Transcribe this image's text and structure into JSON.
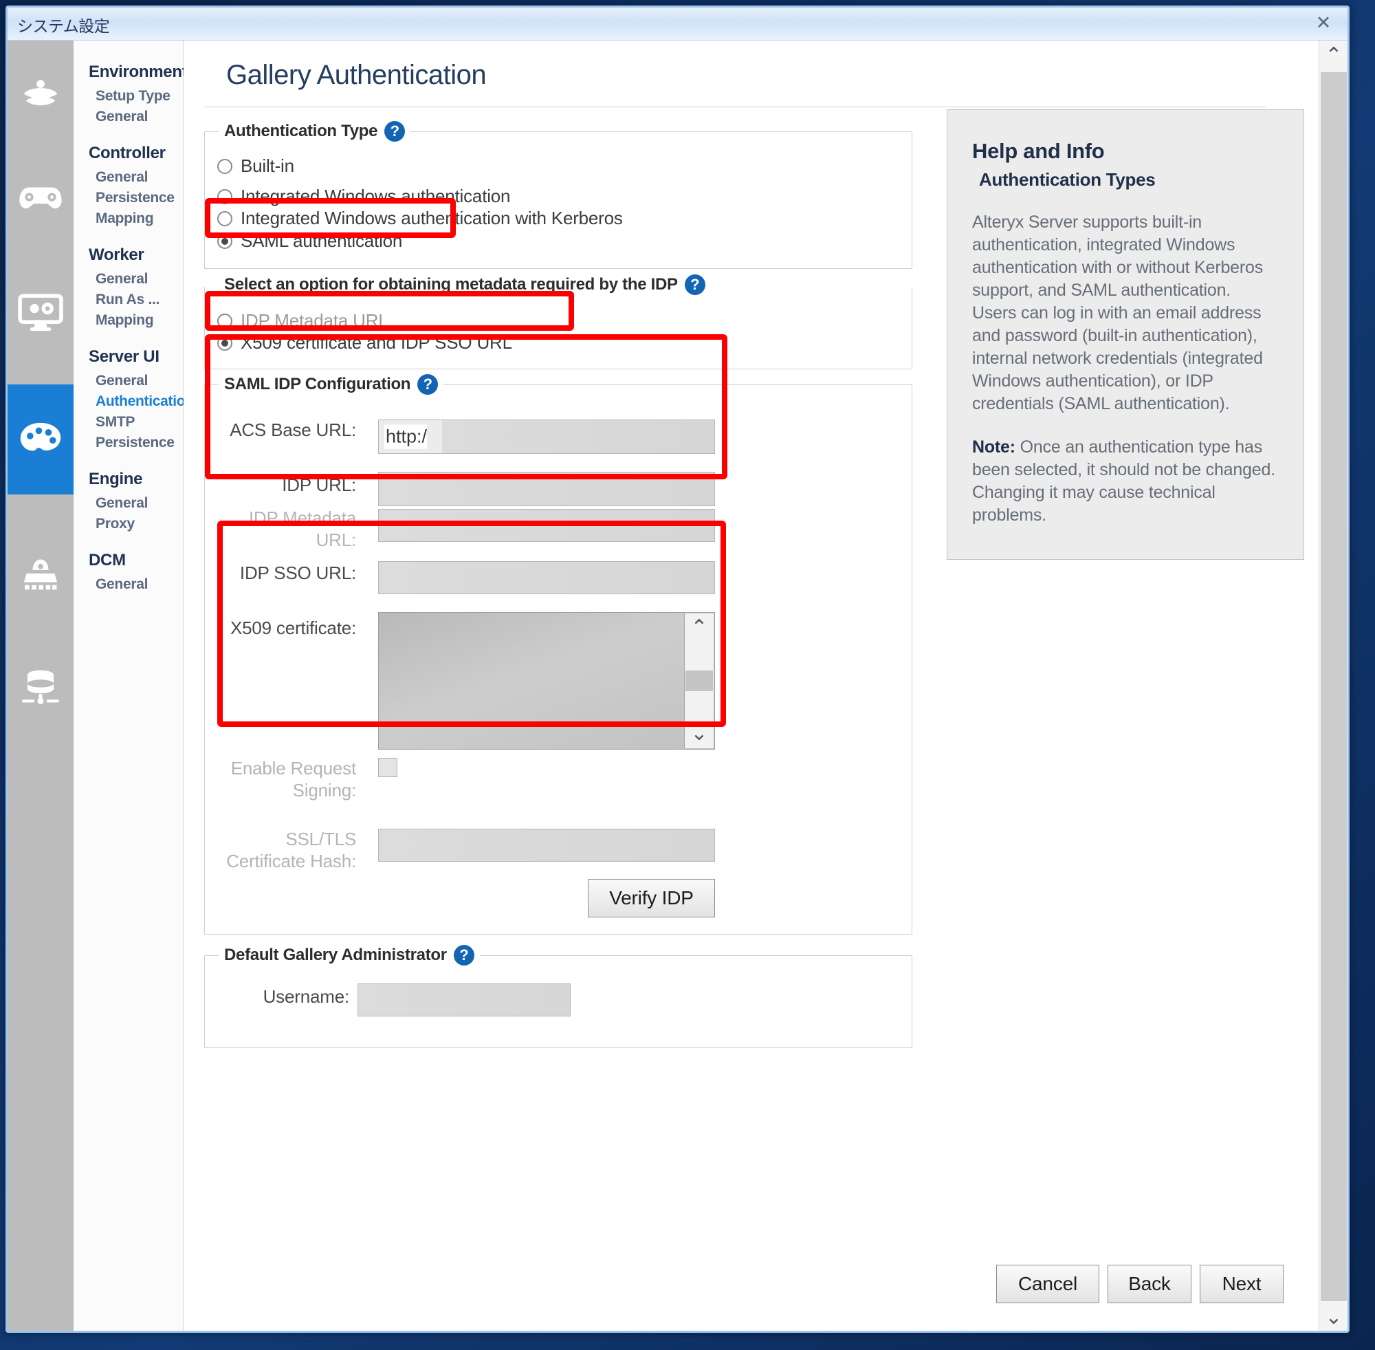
{
  "window": {
    "title": "システム設定",
    "close_label": "✕"
  },
  "icon_rail": [
    {
      "name": "environment-leaf-icon",
      "active": false
    },
    {
      "name": "controller-gamepad-icon",
      "active": false
    },
    {
      "name": "worker-monitor-icon",
      "active": false
    },
    {
      "name": "server-ui-palette-icon",
      "active": true
    },
    {
      "name": "engine-rocket-icon",
      "active": false
    },
    {
      "name": "dcm-database-icon",
      "active": false
    }
  ],
  "nav": {
    "groups": [
      {
        "head": "Environment",
        "items": [
          {
            "label": "Setup Type",
            "selected": false
          },
          {
            "label": "General",
            "selected": false
          }
        ]
      },
      {
        "head": "Controller",
        "items": [
          {
            "label": "General",
            "selected": false
          },
          {
            "label": "Persistence",
            "selected": false
          },
          {
            "label": "Mapping",
            "selected": false
          }
        ]
      },
      {
        "head": "Worker",
        "items": [
          {
            "label": "General",
            "selected": false
          },
          {
            "label": "Run As ...",
            "selected": false
          },
          {
            "label": "Mapping",
            "selected": false
          }
        ]
      },
      {
        "head": "Server UI",
        "items": [
          {
            "label": "General",
            "selected": false
          },
          {
            "label": "Authentication",
            "selected": true
          },
          {
            "label": "SMTP",
            "selected": false
          },
          {
            "label": "Persistence",
            "selected": false
          }
        ]
      },
      {
        "head": "Engine",
        "items": [
          {
            "label": "General",
            "selected": false
          },
          {
            "label": "Proxy",
            "selected": false
          }
        ]
      },
      {
        "head": "DCM",
        "items": [
          {
            "label": "General",
            "selected": false
          }
        ]
      }
    ]
  },
  "page": {
    "title": "Gallery Authentication"
  },
  "auth_type": {
    "legend": "Authentication Type",
    "help_glyph": "?",
    "options": [
      {
        "label": "Built-in",
        "selected": false
      },
      {
        "label": "Integrated Windows authentication",
        "selected": false
      },
      {
        "label": "Integrated Windows authentication with Kerberos",
        "selected": false
      },
      {
        "label": "SAML authentication",
        "selected": true
      }
    ]
  },
  "metadata_option": {
    "legend": "Select an option for obtaining metadata required by the IDP",
    "help_glyph": "?",
    "options": [
      {
        "label": "IDP Metadata URL",
        "selected": false
      },
      {
        "label": "X509 certificate and IDP SSO URL",
        "selected": true
      }
    ]
  },
  "saml_idp": {
    "legend": "SAML IDP Configuration",
    "help_glyph": "?",
    "fields": [
      {
        "label": "ACS Base URL:",
        "value_prefix": "http:/",
        "masked": true,
        "disabled": false
      },
      {
        "label": "IDP URL:",
        "value_prefix": "",
        "masked": true,
        "disabled": false
      },
      {
        "label": "IDP Metadata URL:",
        "value_prefix": "",
        "masked": true,
        "disabled": true
      },
      {
        "label": "IDP SSO URL:",
        "value_prefix": "",
        "masked": true,
        "disabled": false
      },
      {
        "label": "X509 certificate:",
        "value_prefix": "",
        "masked": true,
        "disabled": false
      },
      {
        "label": "Enable Request Signing:",
        "value_prefix": "",
        "masked": false,
        "disabled": true
      },
      {
        "label": "SSL/TLS Certificate Hash:",
        "value_prefix": "",
        "masked": true,
        "disabled": true
      }
    ],
    "verify_button": "Verify IDP",
    "scroll_up_glyph": "⌃",
    "scroll_down_glyph": "⌄"
  },
  "default_admin": {
    "legend": "Default Gallery Administrator",
    "help_glyph": "?",
    "username_label": "Username:",
    "username_value": ""
  },
  "help_panel": {
    "title": "Help and Info",
    "subtitle": "Authentication Types",
    "body": "Alteryx Server supports built-in authentication, integrated Windows authentication with or without Kerberos support, and SAML authentication. Users can log in with an email address and password (built-in authentication), internal network credentials (integrated Windows authentication), or IDP credentials (SAML authentication).",
    "note_label": "Note:",
    "note_body": " Once an authentication type has been selected, it should not be changed. Changing it may cause technical problems."
  },
  "footer": {
    "cancel": "Cancel",
    "back": "Back",
    "next": "Next"
  },
  "scrollbar": {
    "up_glyph": "⌃",
    "down_glyph": "⌄"
  },
  "colors": {
    "accent": "#1a7fd4",
    "highlight": "#fc0000",
    "link": "#1a7fd4",
    "titlebar": "#cfe2f7"
  }
}
